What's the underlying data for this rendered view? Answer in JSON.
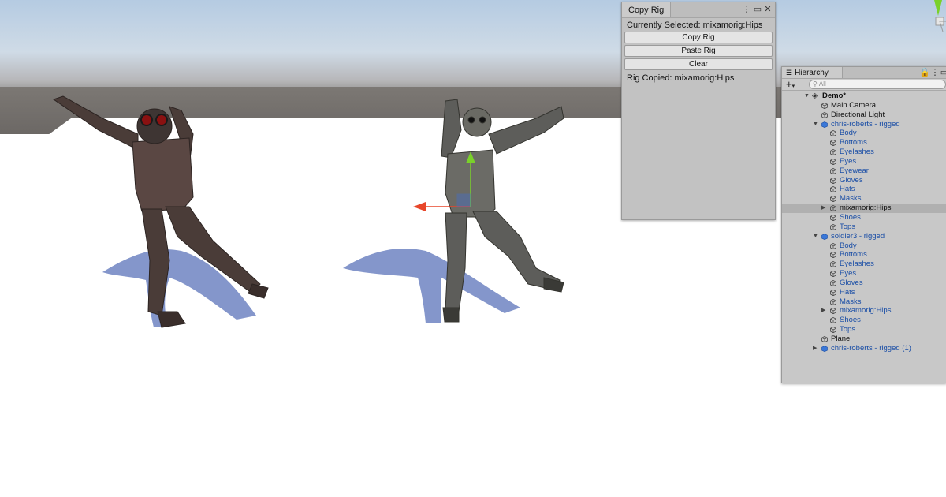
{
  "copy_rig": {
    "tab_title": "Copy Rig",
    "currently_selected": "Currently Selected: mixamorig:Hips",
    "copy_button": "Copy Rig",
    "paste_button": "Paste Rig",
    "clear_button": "Clear",
    "status": "Rig Copied: mixamorig:Hips"
  },
  "hierarchy": {
    "tab_title": "Hierarchy",
    "search_placeholder": "All",
    "scene_name": "Demo*",
    "rows": [
      {
        "label": "Main Camera"
      },
      {
        "label": "Directional Light"
      },
      {
        "label": "chris-roberts - rigged"
      },
      {
        "label": "Body"
      },
      {
        "label": "Bottoms"
      },
      {
        "label": "Eyelashes"
      },
      {
        "label": "Eyes"
      },
      {
        "label": "Eyewear"
      },
      {
        "label": "Gloves"
      },
      {
        "label": "Hats"
      },
      {
        "label": "Masks"
      },
      {
        "label": "mixamorig:Hips"
      },
      {
        "label": "Shoes"
      },
      {
        "label": "Tops"
      },
      {
        "label": "soldier3 - rigged"
      },
      {
        "label": "Body"
      },
      {
        "label": "Bottoms"
      },
      {
        "label": "Eyelashes"
      },
      {
        "label": "Eyes"
      },
      {
        "label": "Gloves"
      },
      {
        "label": "Hats"
      },
      {
        "label": "Masks"
      },
      {
        "label": "mixamorig:Hips"
      },
      {
        "label": "Shoes"
      },
      {
        "label": "Tops"
      },
      {
        "label": "Plane"
      },
      {
        "label": "chris-roberts - rigged (1)"
      }
    ]
  },
  "colors": {
    "prefab_blue": "#1a4ea6",
    "selected_row": "#b0b0b0",
    "gizmo_x": "#e8462a",
    "gizmo_y": "#7ad12a",
    "gizmo_z": "#3b6ee0"
  }
}
